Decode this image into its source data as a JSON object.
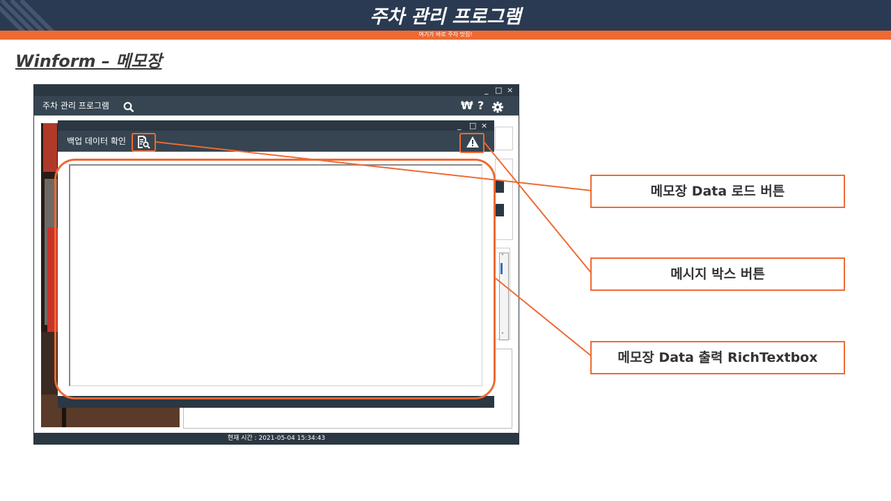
{
  "slide": {
    "title": "주차 관리 프로그램",
    "subtitle": "여기가 바로 주차 맛집!",
    "section_title": "Winform – 메모장"
  },
  "main_window": {
    "app_title": "주차 관리 프로그램",
    "controls": {
      "min": "_",
      "max": "□",
      "close": "×"
    },
    "toolbar_icons": [
      "search-icon",
      "won-icon",
      "help-icon",
      "gear-icon"
    ],
    "won_label": "₩",
    "help_label": "?",
    "status_text": "현재 시간 : 2021-05-04 15:34:43"
  },
  "backup_window": {
    "title": "백업 데이터 확인",
    "controls": {
      "min": "_",
      "max": "□",
      "close": "×"
    },
    "icons": [
      "memo-load-icon",
      "warning-icon"
    ],
    "rich_text": ""
  },
  "callouts": {
    "load_button": "메모장 Data 로드 버튼",
    "message_box_button": "메시지 박스 버튼",
    "rich_textbox": "메모장 Data 출력 RichTextbox"
  },
  "colors": {
    "header_navy": "#2a3a52",
    "accent_orange": "#ee6a32",
    "window_dark": "#2b3742",
    "toolbar_dark": "#364551"
  }
}
